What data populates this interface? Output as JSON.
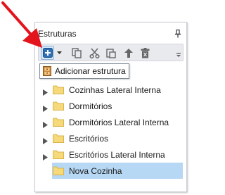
{
  "panel": {
    "title": "Estruturas",
    "pin_icon": "pin-icon"
  },
  "toolbar": {
    "buttons": [
      {
        "name": "add",
        "icon": "plus-icon"
      },
      {
        "name": "dropdown",
        "icon": "chevron-down-icon"
      },
      {
        "name": "copy",
        "icon": "copy-icon"
      },
      {
        "name": "cut",
        "icon": "scissors-icon"
      },
      {
        "name": "paste",
        "icon": "paste-icon"
      },
      {
        "name": "move-up",
        "icon": "arrow-up-icon"
      },
      {
        "name": "delete",
        "icon": "trash-icon"
      }
    ],
    "accent_color": "#2e6fb4"
  },
  "tooltip": {
    "text": "Adicionar estrutura",
    "icon": "structure-icon"
  },
  "tree": {
    "items": [
      {
        "label": "Cozinhas Lateral Interna",
        "expandable": true,
        "selected": false
      },
      {
        "label": "Dormitórios",
        "expandable": true,
        "selected": false
      },
      {
        "label": "Dormitórios Lateral Interna",
        "expandable": true,
        "selected": false
      },
      {
        "label": "Escritórios",
        "expandable": true,
        "selected": false
      },
      {
        "label": "Escritórios Lateral Interna",
        "expandable": true,
        "selected": false
      },
      {
        "label": "Nova Cozinha",
        "expandable": false,
        "selected": true
      }
    ],
    "folder_color": "#f5d97a",
    "selection_color": "#b7d8f4"
  },
  "annotation": {
    "arrow_color": "#e3141b"
  }
}
